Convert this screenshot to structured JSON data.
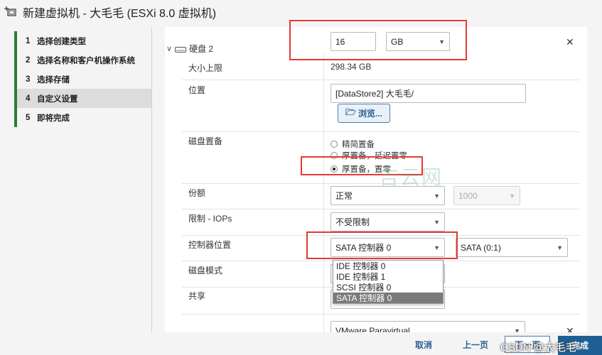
{
  "window": {
    "title": "新建虚拟机 - 大毛毛 (ESXi 8.0 虚拟机)"
  },
  "steps": [
    {
      "num": "1",
      "label": "选择创建类型"
    },
    {
      "num": "2",
      "label": "选择名称和客户机操作系统"
    },
    {
      "num": "3",
      "label": "选择存储"
    },
    {
      "num": "4",
      "label": "自定义设置"
    },
    {
      "num": "5",
      "label": "即将完成"
    }
  ],
  "disk": {
    "header": "硬盘 2",
    "size_value": "16",
    "size_unit": "GB",
    "max_size_label": "大小上限",
    "max_size_value": "298.34 GB",
    "location_label": "位置",
    "location_value": "[DataStore2] 大毛毛/",
    "browse_label": "浏览...",
    "provision_label": "磁盘置备",
    "provision_options": [
      "精简置备",
      "厚置备，延迟置零",
      "厚置备，置零"
    ],
    "shares_label": "份额",
    "shares_value": "正常",
    "shares_number": "1000",
    "iops_label": "限制 - IOPs",
    "iops_value": "不受限制",
    "controller_label": "控制器位置",
    "controller_value": "SATA 控制器 0",
    "controller_slot": "SATA (0:1)",
    "controller_options": [
      "IDE 控制器 0",
      "IDE 控制器 1",
      "SCSI 控制器 0",
      "SATA 控制器 0"
    ],
    "mode_label": "磁盘模式",
    "sharing_label": "共享"
  },
  "next_section": {
    "value": "VMware Paravirtual"
  },
  "footer": {
    "cancel": "取消",
    "back": "上一页",
    "next": "下一页",
    "finish": "完成"
  },
  "watermarks": {
    "center": "吉云网",
    "corner": "CSDN @大毛毛~"
  }
}
